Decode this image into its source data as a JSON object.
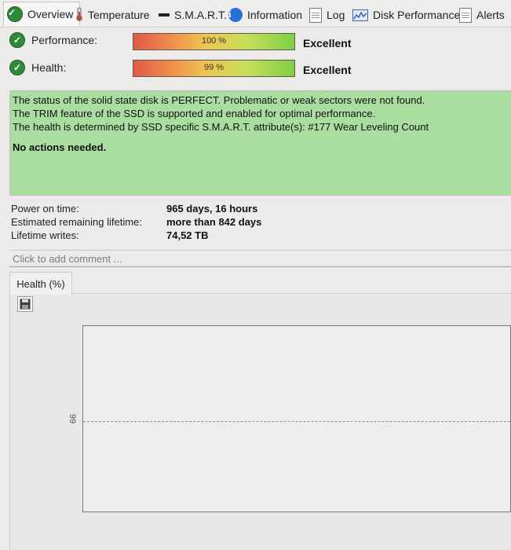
{
  "tabs": [
    {
      "label": "Overview",
      "icon": "check-icon"
    },
    {
      "label": "Temperature",
      "icon": "thermometer-icon"
    },
    {
      "label": "S.M.A.R.T.",
      "icon": "smart-icon"
    },
    {
      "label": "Information",
      "icon": "info-icon"
    },
    {
      "label": "Log",
      "icon": "document-icon"
    },
    {
      "label": "Disk Performance",
      "icon": "performance-icon"
    },
    {
      "label": "Alerts",
      "icon": "alerts-icon"
    }
  ],
  "performance": {
    "label": "Performance:",
    "percent_text": "100 %",
    "value": 100,
    "rating": "Excellent"
  },
  "health": {
    "label": "Health:",
    "percent_text": "99 %",
    "value": 99,
    "rating": "Excellent"
  },
  "status": {
    "line1": "The status of the solid state disk is PERFECT. Problematic or weak sectors were not found.",
    "line2": "The TRIM feature of the SSD is supported and enabled for optimal performance.",
    "line3": "The health is determined by SSD specific S.M.A.R.T. attribute(s):  #177 Wear Leveling Count",
    "action": "No actions needed.",
    "color": "#a9dea0"
  },
  "details": {
    "power_on_label": "Power on time:",
    "power_on_value": "965 days, 16 hours",
    "lifetime_label": "Estimated remaining lifetime:",
    "lifetime_value": "more than 842 days",
    "writes_label": "Lifetime writes:",
    "writes_value": "74,52 TB"
  },
  "comment": {
    "placeholder": "Click to add comment ..."
  },
  "chart": {
    "tab_label": "Health (%)",
    "y_tick": "99"
  }
}
